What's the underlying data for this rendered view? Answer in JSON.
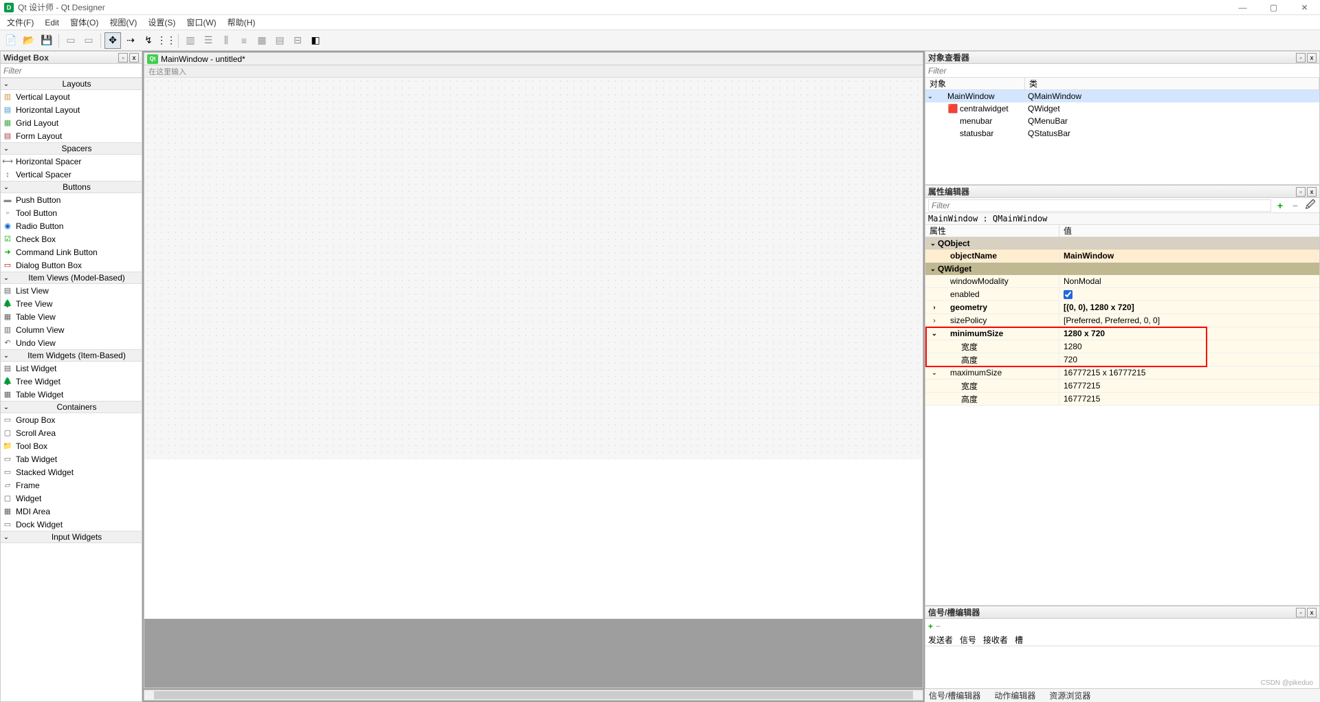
{
  "titlebar": {
    "app_name": "Qt 设计师 - Qt Designer"
  },
  "menubar": {
    "items": [
      "文件(F)",
      "Edit",
      "窗体(O)",
      "视图(V)",
      "设置(S)",
      "窗口(W)",
      "帮助(H)"
    ]
  },
  "widgetbox": {
    "title": "Widget Box",
    "filter_placeholder": "Filter",
    "categories": [
      {
        "name": "Layouts",
        "items": [
          "Vertical Layout",
          "Horizontal Layout",
          "Grid Layout",
          "Form Layout"
        ]
      },
      {
        "name": "Spacers",
        "items": [
          "Horizontal Spacer",
          "Vertical Spacer"
        ]
      },
      {
        "name": "Buttons",
        "items": [
          "Push Button",
          "Tool Button",
          "Radio Button",
          "Check Box",
          "Command Link Button",
          "Dialog Button Box"
        ]
      },
      {
        "name": "Item Views (Model-Based)",
        "items": [
          "List View",
          "Tree View",
          "Table View",
          "Column View",
          "Undo View"
        ]
      },
      {
        "name": "Item Widgets (Item-Based)",
        "items": [
          "List Widget",
          "Tree Widget",
          "Table Widget"
        ]
      },
      {
        "name": "Containers",
        "items": [
          "Group Box",
          "Scroll Area",
          "Tool Box",
          "Tab Widget",
          "Stacked Widget",
          "Frame",
          "Widget",
          "MDI Area",
          "Dock Widget"
        ]
      },
      {
        "name": "Input Widgets",
        "items": []
      }
    ]
  },
  "canvas": {
    "title": "MainWindow - untitled*",
    "menubar_hint": "在这里输入"
  },
  "object_inspector": {
    "title": "对象查看器",
    "filter_placeholder": "Filter",
    "header": {
      "col1": "对象",
      "col2": "类"
    },
    "rows": [
      {
        "indent": 0,
        "exp": "⌄",
        "name": "MainWindow",
        "class": "QMainWindow",
        "sel": true,
        "icon": ""
      },
      {
        "indent": 1,
        "exp": "",
        "name": "centralwidget",
        "class": "QWidget",
        "icon": "🟥"
      },
      {
        "indent": 1,
        "exp": "",
        "name": "menubar",
        "class": "QMenuBar",
        "icon": ""
      },
      {
        "indent": 1,
        "exp": "",
        "name": "statusbar",
        "class": "QStatusBar",
        "icon": ""
      }
    ]
  },
  "property_editor": {
    "title": "属性编辑器",
    "filter_placeholder": "Filter",
    "crumb": "MainWindow : QMainWindow",
    "header": {
      "col1": "属性",
      "col2": "值"
    },
    "sections": [
      {
        "name": "QObject",
        "class": "qobject",
        "rows": [
          {
            "name": "objectName",
            "value": "MainWindow",
            "bold": true,
            "indent": 1,
            "orange": true
          }
        ]
      },
      {
        "name": "QWidget",
        "class": "qwidget",
        "rows": [
          {
            "name": "windowModality",
            "value": "NonModal",
            "indent": 1
          },
          {
            "name": "enabled",
            "value": "☑",
            "indent": 1,
            "checkbox": true
          },
          {
            "name": "geometry",
            "value": "[(0, 0), 1280 x 720]",
            "bold": true,
            "indent": 1,
            "exp": "›"
          },
          {
            "name": "sizePolicy",
            "value": "[Preferred, Preferred, 0, 0]",
            "indent": 1,
            "exp": "›"
          },
          {
            "name": "minimumSize",
            "value": "1280 x 720",
            "bold": true,
            "indent": 1,
            "exp": "⌄",
            "hl": true
          },
          {
            "name": "宽度",
            "value": "1280",
            "indent": 2,
            "hl": true
          },
          {
            "name": "高度",
            "value": "720",
            "indent": 2,
            "hl": true
          },
          {
            "name": "maximumSize",
            "value": "16777215 x 16777215",
            "indent": 1,
            "exp": "⌄"
          },
          {
            "name": "宽度",
            "value": "16777215",
            "indent": 2
          },
          {
            "name": "高度",
            "value": "16777215",
            "indent": 2
          }
        ]
      }
    ]
  },
  "signal_editor": {
    "title": "信号/槽编辑器",
    "header": {
      "c1": "发送者",
      "c2": "信号",
      "c3": "接收者",
      "c4": "槽"
    }
  },
  "bottom_tabs": {
    "items": [
      "信号/槽编辑器",
      "动作编辑器",
      "资源浏览器"
    ]
  },
  "watermark": "CSDN @pikeduo"
}
